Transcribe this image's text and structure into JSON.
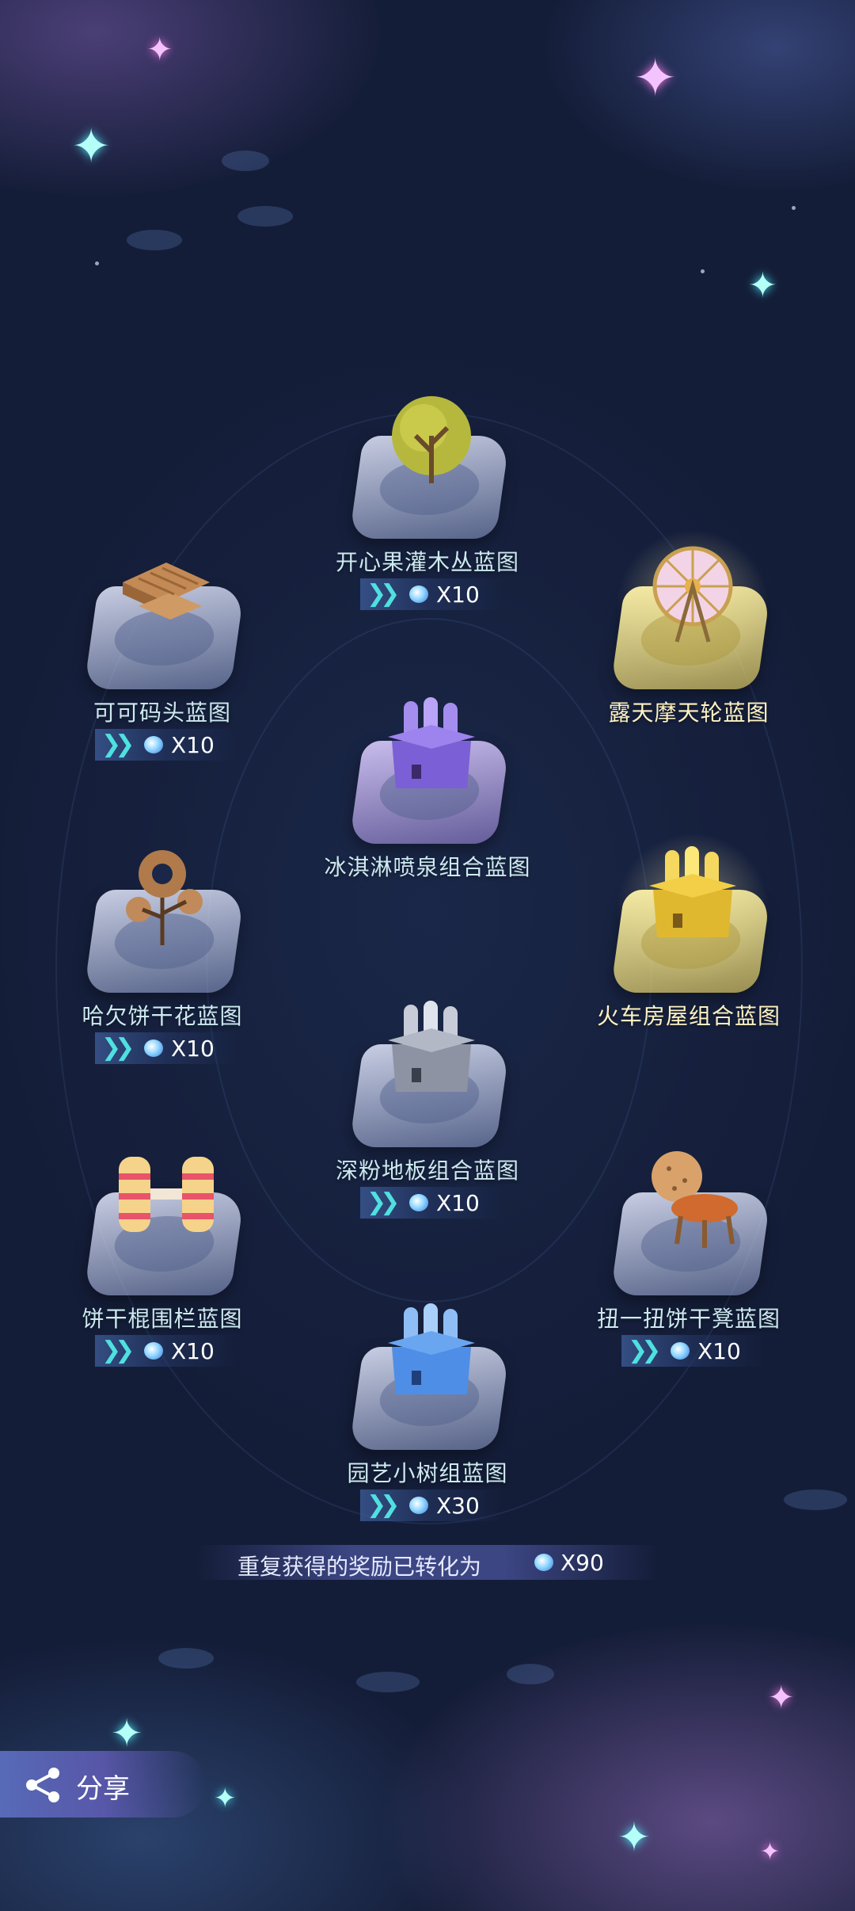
{
  "items": [
    {
      "name": "开心果灌木丛蓝图",
      "reward": "X10",
      "rarity": "normal",
      "icon": "pistachio-bush-icon"
    },
    {
      "name": "可可码头蓝图",
      "reward": "X10",
      "rarity": "normal",
      "icon": "cocoa-dock-icon"
    },
    {
      "name": "露天摩天轮蓝图",
      "reward": "",
      "rarity": "gold",
      "icon": "ferris-wheel-icon"
    },
    {
      "name": "冰淇淋喷泉组合蓝图",
      "reward": "",
      "rarity": "purple",
      "icon": "icecream-fountain-icon"
    },
    {
      "name": "哈欠饼干花蓝图",
      "reward": "X10",
      "rarity": "normal",
      "icon": "cookie-flower-icon"
    },
    {
      "name": "火车房屋组合蓝图",
      "reward": "",
      "rarity": "gold",
      "icon": "train-house-icon"
    },
    {
      "name": "深粉地板组合蓝图",
      "reward": "X10",
      "rarity": "normal",
      "icon": "pink-floor-icon"
    },
    {
      "name": "饼干棍围栏蓝图",
      "reward": "X10",
      "rarity": "normal",
      "icon": "biscuit-fence-icon"
    },
    {
      "name": "扭一扭饼干凳蓝图",
      "reward": "X10",
      "rarity": "normal",
      "icon": "cookie-stool-icon"
    },
    {
      "name": "园艺小树组蓝图",
      "reward": "X30",
      "rarity": "normal",
      "icon": "garden-tree-icon"
    }
  ],
  "summary": {
    "text": "重复获得的奖励已转化为",
    "total": "X90"
  },
  "share": {
    "label": "分享"
  },
  "colors": {
    "background": "#16213e",
    "accent_cyan": "#4fe0e0",
    "gold_title": "#fff3c2"
  }
}
